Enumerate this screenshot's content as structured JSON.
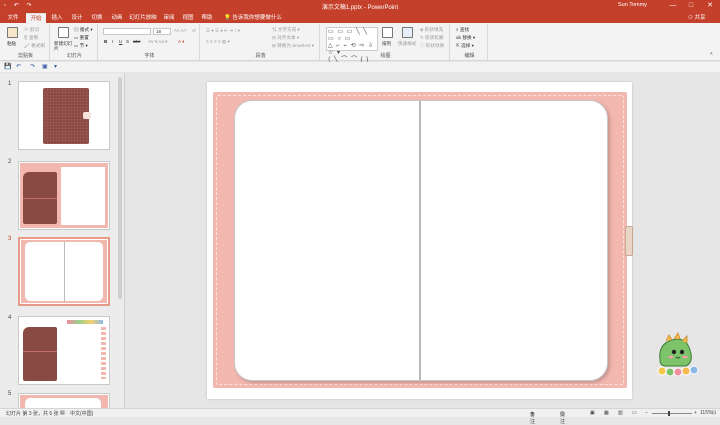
{
  "titlebar": {
    "title": "演示文稿1.pptx - PowerPoint",
    "user": "Sun Tommy",
    "controls": [
      "—",
      "□",
      "✕"
    ]
  },
  "tabs": {
    "items": [
      "文件",
      "开始",
      "插入",
      "设计",
      "切换",
      "动画",
      "幻灯片放映",
      "审阅",
      "视图",
      "帮助"
    ],
    "active": "开始",
    "tell_me": "告诉我你想要做什么",
    "share": "共享"
  },
  "ribbon": {
    "clipboard": {
      "paste": "粘贴",
      "cut": "剪切",
      "copy": "复制",
      "format_painter": "格式刷",
      "label": "剪贴板"
    },
    "slides": {
      "new_slide": "新建幻灯片",
      "layout": "版式",
      "reset": "重置",
      "section": "节",
      "label": "幻灯片"
    },
    "font": {
      "font_name": "",
      "font_size": "18",
      "bold": "B",
      "italic": "I",
      "underline": "U",
      "strike": "S",
      "shadow": "abc",
      "label": "字体"
    },
    "paragraph": {
      "text_direction": "文字方向",
      "align_text": "对齐文本",
      "smartart": "转换为 SmartArt",
      "label": "段落"
    },
    "drawing": {
      "arrange": "排列",
      "quick_styles": "快速样式",
      "shape_fill": "形状填充",
      "shape_outline": "形状轮廓",
      "shape_effects": "形状效果",
      "label": "绘图"
    },
    "editing": {
      "find": "查找",
      "replace": "替换",
      "select": "选择",
      "label": "编辑"
    }
  },
  "thumbnails": [
    {
      "number": "1",
      "selected": false
    },
    {
      "number": "2",
      "selected": false
    },
    {
      "number": "3",
      "selected": true
    },
    {
      "number": "4",
      "selected": false
    },
    {
      "number": "5",
      "selected": false
    }
  ],
  "status": {
    "slide_info": "幻灯片 第 3 张，共 6 张",
    "language": "中文(中国)",
    "notes": "备注",
    "comments": "批注",
    "zoom": "115%"
  },
  "colors": {
    "accent": "#c4402a",
    "cover_pink": "#f2b8b0",
    "cover_brown": "#8a4a44"
  }
}
